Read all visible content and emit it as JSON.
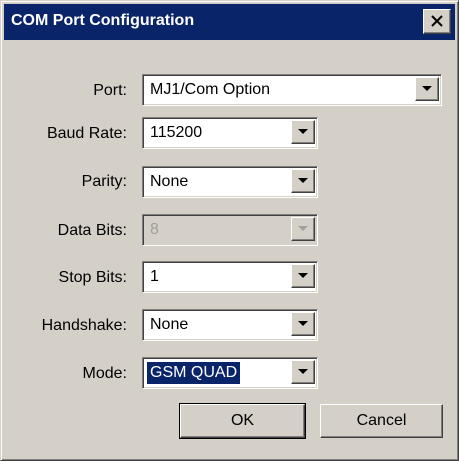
{
  "window": {
    "title": "COM Port Configuration",
    "close_icon": "close-icon"
  },
  "fields": {
    "port": {
      "label": "Port:",
      "value": "MJ1/Com Option"
    },
    "baud_rate": {
      "label": "Baud Rate:",
      "value": "115200"
    },
    "parity": {
      "label": "Parity:",
      "value": "None"
    },
    "data_bits": {
      "label": "Data Bits:",
      "value": "8",
      "disabled": true
    },
    "stop_bits": {
      "label": "Stop Bits:",
      "value": "1"
    },
    "handshake": {
      "label": "Handshake:",
      "value": "None"
    },
    "mode": {
      "label": "Mode:",
      "value": "GSM QUAD",
      "focused": true
    }
  },
  "buttons": {
    "ok_label": "OK",
    "cancel_label": "Cancel"
  },
  "colors": {
    "titlebar": "#0a246a",
    "face": "#d4d0c8",
    "selection": "#0a246a"
  }
}
